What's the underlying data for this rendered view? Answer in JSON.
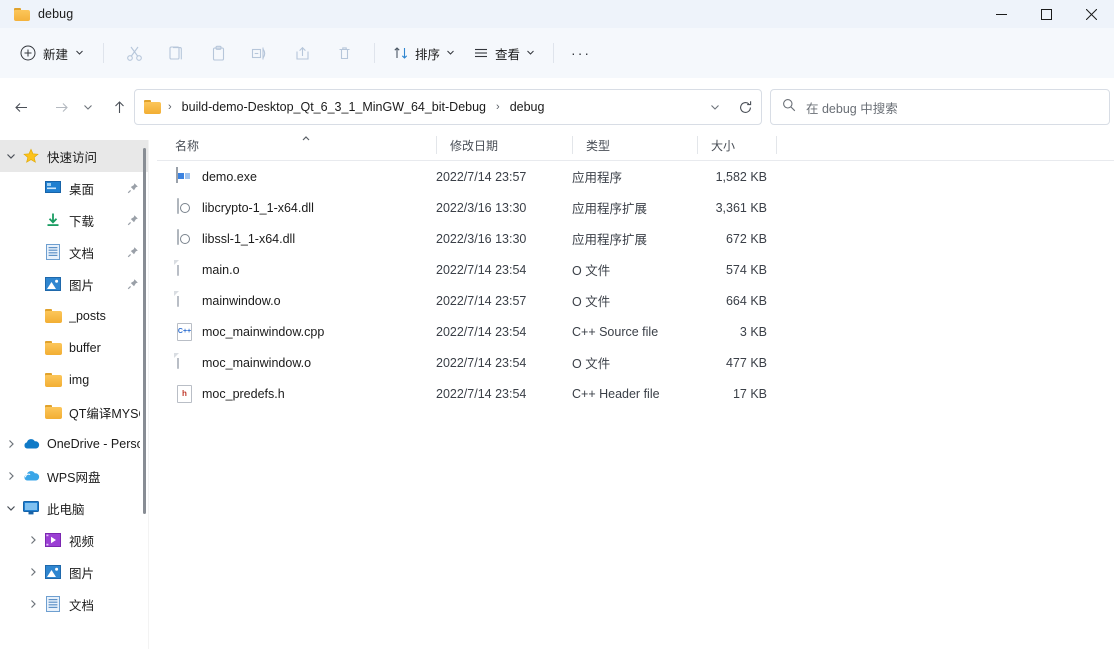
{
  "window": {
    "title": "debug",
    "controls": {
      "minimize": "minimize-button",
      "maximize": "maximize-button",
      "close": "close-button"
    }
  },
  "toolbar": {
    "new_label": "新建",
    "buttons": [
      {
        "name": "cut-button",
        "icon": "scissors-icon"
      },
      {
        "name": "copy-button",
        "icon": "copy-icon"
      },
      {
        "name": "paste-button",
        "icon": "clipboard-icon"
      },
      {
        "name": "rename-button",
        "icon": "rename-icon"
      },
      {
        "name": "share-button",
        "icon": "share-icon"
      },
      {
        "name": "delete-button",
        "icon": "trash-icon"
      }
    ],
    "sort_label": "排序",
    "view_label": "查看",
    "more_label": "···"
  },
  "address": {
    "crumbs": [
      "build-demo-Desktop_Qt_6_3_1_MinGW_64_bit-Debug",
      "debug"
    ],
    "separator": "›"
  },
  "search": {
    "placeholder": "在 debug 中搜索"
  },
  "sidebar": {
    "items": [
      {
        "label": "快速访问",
        "icon": "star-icon",
        "arrow": "expanded",
        "indent": 0,
        "pinned": false,
        "selected": true
      },
      {
        "label": "桌面",
        "icon": "desktop-icon",
        "arrow": "none",
        "indent": 1,
        "pinned": true,
        "selected": false
      },
      {
        "label": "下载",
        "icon": "download-icon",
        "arrow": "none",
        "indent": 1,
        "pinned": true,
        "selected": false
      },
      {
        "label": "文档",
        "icon": "document-icon",
        "arrow": "none",
        "indent": 1,
        "pinned": true,
        "selected": false
      },
      {
        "label": "图片",
        "icon": "pictures-icon",
        "arrow": "none",
        "indent": 1,
        "pinned": true,
        "selected": false
      },
      {
        "label": "_posts",
        "icon": "folder-icon",
        "arrow": "none",
        "indent": 1,
        "pinned": false,
        "selected": false
      },
      {
        "label": "buffer",
        "icon": "folder-icon",
        "arrow": "none",
        "indent": 1,
        "pinned": false,
        "selected": false
      },
      {
        "label": "img",
        "icon": "folder-icon",
        "arrow": "none",
        "indent": 1,
        "pinned": false,
        "selected": false
      },
      {
        "label": "QT编译MYSQL",
        "icon": "folder-icon",
        "arrow": "none",
        "indent": 1,
        "pinned": false,
        "selected": false
      },
      {
        "label": "OneDrive - Personal",
        "icon": "onedrive-icon",
        "arrow": "collapsed",
        "indent": 0,
        "pinned": false,
        "selected": false
      },
      {
        "label": "WPS网盘",
        "icon": "wps-cloud-icon",
        "arrow": "collapsed",
        "indent": 0,
        "pinned": false,
        "selected": false
      },
      {
        "label": "此电脑",
        "icon": "this-pc-icon",
        "arrow": "expanded",
        "indent": 0,
        "pinned": false,
        "selected": false
      },
      {
        "label": "视频",
        "icon": "videos-icon",
        "arrow": "collapsed",
        "indent": 1,
        "pinned": false,
        "selected": false
      },
      {
        "label": "图片",
        "icon": "pictures-icon",
        "arrow": "collapsed",
        "indent": 1,
        "pinned": false,
        "selected": false
      },
      {
        "label": "文档",
        "icon": "document-icon",
        "arrow": "collapsed",
        "indent": 1,
        "pinned": false,
        "selected": false
      }
    ]
  },
  "filelist": {
    "columns": [
      {
        "label": "名称",
        "sort": "asc"
      },
      {
        "label": "修改日期",
        "sort": "none"
      },
      {
        "label": "类型",
        "sort": "none"
      },
      {
        "label": "大小",
        "sort": "none"
      }
    ],
    "rows": [
      {
        "name": "demo.exe",
        "icon": "exe-file-icon",
        "date": "2022/7/14 23:57",
        "type": "应用程序",
        "size": "1,582 KB"
      },
      {
        "name": "libcrypto-1_1-x64.dll",
        "icon": "dll-file-icon",
        "date": "2022/3/16 13:30",
        "type": "应用程序扩展",
        "size": "3,361 KB"
      },
      {
        "name": "libssl-1_1-x64.dll",
        "icon": "dll-file-icon",
        "date": "2022/3/16 13:30",
        "type": "应用程序扩展",
        "size": "672 KB"
      },
      {
        "name": "main.o",
        "icon": "blank-file-icon",
        "date": "2022/7/14 23:54",
        "type": "O 文件",
        "size": "574 KB"
      },
      {
        "name": "mainwindow.o",
        "icon": "blank-file-icon",
        "date": "2022/7/14 23:57",
        "type": "O 文件",
        "size": "664 KB"
      },
      {
        "name": "moc_mainwindow.cpp",
        "icon": "cpp-file-icon",
        "date": "2022/7/14 23:54",
        "type": "C++ Source file",
        "size": "3 KB"
      },
      {
        "name": "moc_mainwindow.o",
        "icon": "blank-file-icon",
        "date": "2022/7/14 23:54",
        "type": "O 文件",
        "size": "477 KB"
      },
      {
        "name": "moc_predefs.h",
        "icon": "h-file-icon",
        "date": "2022/7/14 23:54",
        "type": "C++ Header file",
        "size": "17 KB"
      }
    ]
  },
  "colors": {
    "titlebar_bg": "#eef3fa",
    "commandbar_bg": "#f5f8fc",
    "accent_folder": "#f4b23c",
    "selection": "#e8e8e8"
  }
}
